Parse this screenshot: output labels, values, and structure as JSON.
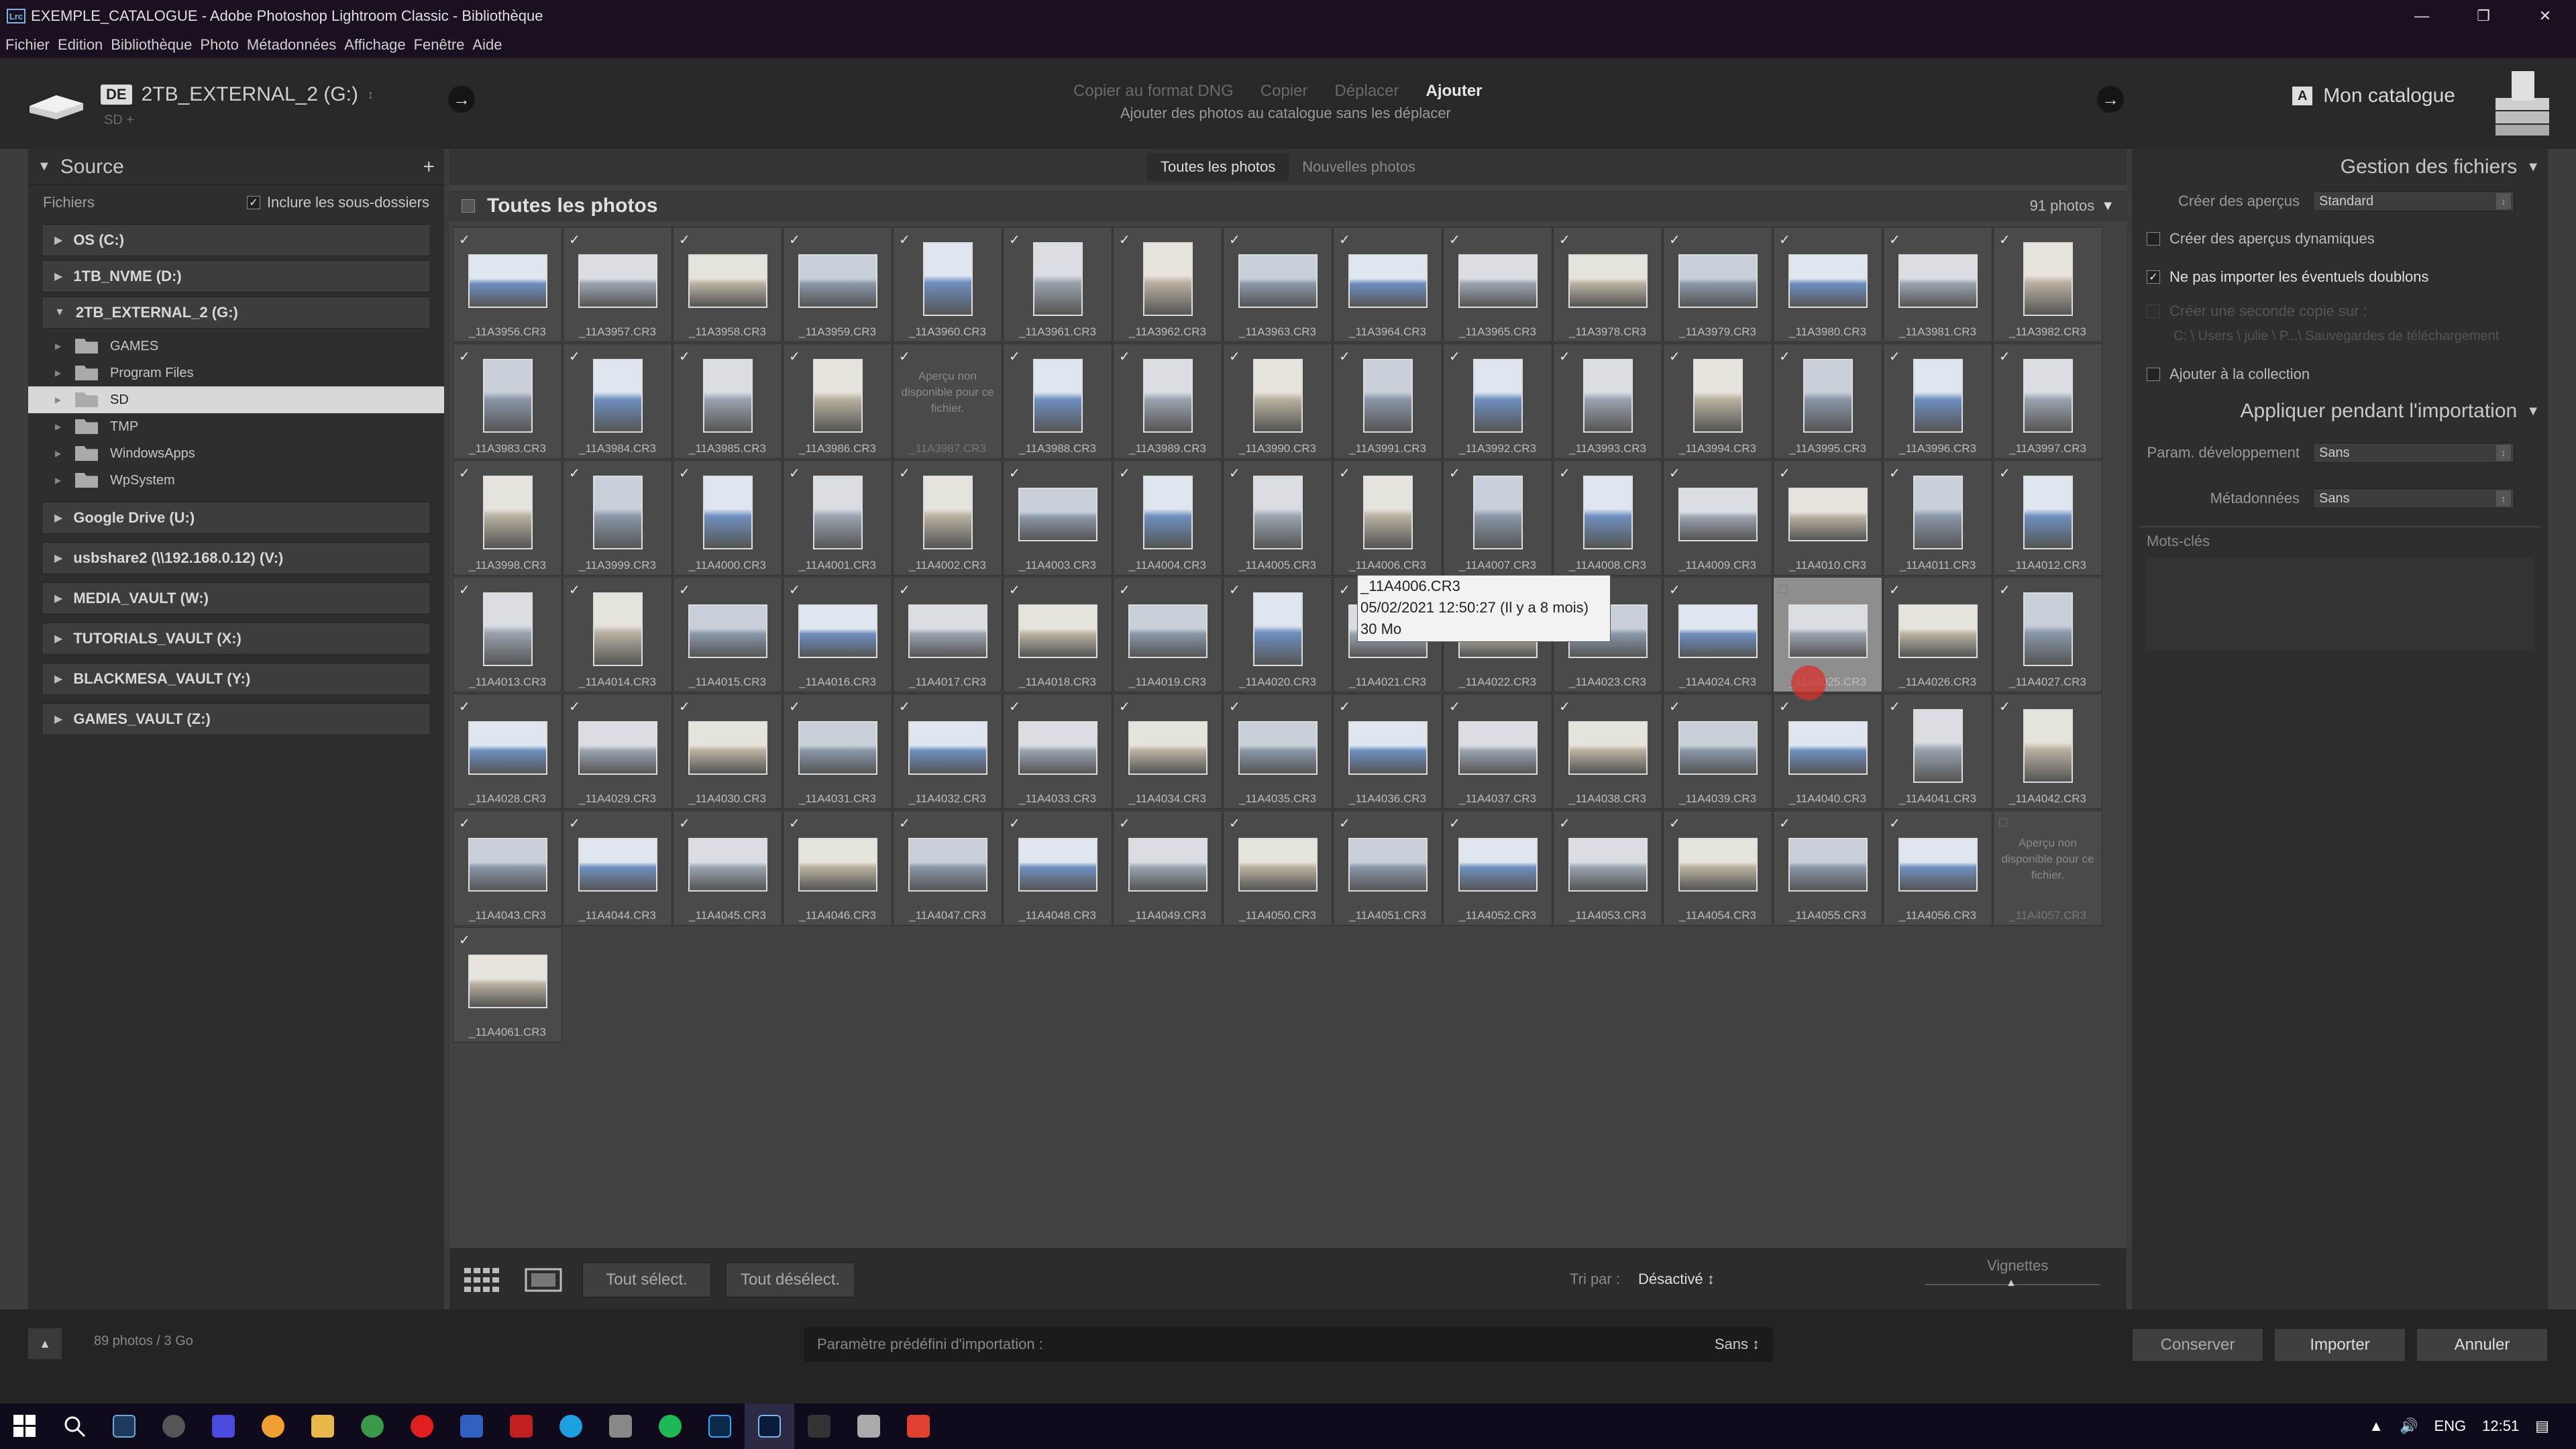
{
  "window": {
    "title": "EXEMPLE_CATALOGUE - Adobe Photoshop Lightroom Classic - Bibliothèque",
    "app_badge": "Lrc"
  },
  "menu": [
    "Fichier",
    "Edition",
    "Bibliothèque",
    "Photo",
    "Métadonnées",
    "Affichage",
    "Fenêtre",
    "Aide"
  ],
  "source_header": {
    "badge": "DE",
    "drive": "2TB_EXTERNAL_2 (G:)",
    "path": "SD +"
  },
  "modes": {
    "items": [
      "Copier au format DNG",
      "Copier",
      "Déplacer",
      "Ajouter"
    ],
    "active": "Ajouter",
    "subtitle": "Ajouter des photos au catalogue sans les déplacer"
  },
  "destination": {
    "badge": "A",
    "label": "Mon catalogue"
  },
  "left_panel": {
    "title": "Source",
    "files_label": "Fichiers",
    "include_sub": "Inclure les sous-dossiers",
    "volumes_top": [
      "OS (C:)",
      "1TB_NVME (D:)",
      "2TB_EXTERNAL_2 (G:)"
    ],
    "folders": [
      "GAMES",
      "Program Files",
      "SD",
      "TMP",
      "WindowsApps",
      "WpSystem"
    ],
    "selected_folder": "SD",
    "volumes_bottom": [
      "Google Drive (U:)",
      "usbshare2 (\\\\192.168.0.12) (V:)",
      "MEDIA_VAULT (W:)",
      "TUTORIALS_VAULT (X:)",
      "BLACKMESA_VAULT (Y:)",
      "GAMES_VAULT (Z:)"
    ]
  },
  "grid": {
    "tabs": [
      "Toutes les photos",
      "Nouvelles photos"
    ],
    "active_tab": "Toutes les photos",
    "title": "Toutes les photos",
    "count": "91 photos",
    "unavailable_text": "Aperçu non disponible pour ce fichier.",
    "tooltip": {
      "name": "_11A4006.CR3",
      "date": "05/02/2021 12:50:27 (Il y a 8 mois)",
      "size": "30 Mo"
    },
    "files": [
      "_11A3956.CR3",
      "_11A3957.CR3",
      "_11A3958.CR3",
      "_11A3959.CR3",
      "_11A3960.CR3",
      "_11A3961.CR3",
      "_11A3962.CR3",
      "_11A3963.CR3",
      "_11A3964.CR3",
      "_11A3965.CR3",
      "_11A3978.CR3",
      "_11A3979.CR3",
      "_11A3980.CR3",
      "_11A3981.CR3",
      "_11A3982.CR3",
      "_11A3983.CR3",
      "_11A3984.CR3",
      "_11A3985.CR3",
      "_11A3986.CR3",
      "_11A3987.CR3",
      "_11A3988.CR3",
      "_11A3989.CR3",
      "_11A3990.CR3",
      "_11A3991.CR3",
      "_11A3992.CR3",
      "_11A3993.CR3",
      "_11A3994.CR3",
      "_11A3995.CR3",
      "_11A3996.CR3",
      "_11A3997.CR3",
      "_11A3998.CR3",
      "_11A3999.CR3",
      "_11A4000.CR3",
      "_11A4001.CR3",
      "_11A4002.CR3",
      "_11A4003.CR3",
      "_11A4004.CR3",
      "_11A4005.CR3",
      "_11A4006.CR3",
      "_11A4007.CR3",
      "_11A4008.CR3",
      "_11A4009.CR3",
      "_11A4010.CR3",
      "_11A4011.CR3",
      "_11A4012.CR3",
      "_11A4013.CR3",
      "_11A4014.CR3",
      "_11A4015.CR3",
      "_11A4016.CR3",
      "_11A4017.CR3",
      "_11A4018.CR3",
      "_11A4019.CR3",
      "_11A4020.CR3",
      "_11A4021.CR3",
      "_11A4022.CR3",
      "_11A4023.CR3",
      "_11A4024.CR3",
      "_11A4025.CR3",
      "_11A4026.CR3",
      "_11A4027.CR3",
      "_11A4028.CR3",
      "_11A4029.CR3",
      "_11A4030.CR3",
      "_11A4031.CR3",
      "_11A4032.CR3",
      "_11A4033.CR3",
      "_11A4034.CR3",
      "_11A4035.CR3",
      "_11A4036.CR3",
      "_11A4037.CR3",
      "_11A4038.CR3",
      "_11A4039.CR3",
      "_11A4040.CR3",
      "_11A4041.CR3",
      "_11A4042.CR3",
      "_11A4043.CR3",
      "_11A4044.CR3",
      "_11A4045.CR3",
      "_11A4046.CR3",
      "_11A4047.CR3",
      "_11A4048.CR3",
      "_11A4049.CR3",
      "_11A4050.CR3",
      "_11A4051.CR3",
      "_11A4052.CR3",
      "_11A4053.CR3",
      "_11A4054.CR3",
      "_11A4055.CR3",
      "_11A4056.CR3",
      "_11A4057.CR3",
      "_11A4061.CR3"
    ],
    "unavailable": [
      "_11A3987.CR3",
      "_11A4057.CR3"
    ],
    "unchecked": [
      "_11A4025.CR3",
      "_11A4057.CR3"
    ],
    "highlighted": "_11A4025.CR3",
    "hovered": "_11A4006.CR3"
  },
  "grid_footer": {
    "select_all": "Tout sélect.",
    "deselect_all": "Tout désélect.",
    "sort_label": "Tri par :",
    "sort_value": "Désactivé",
    "thumbs_label": "Vignettes"
  },
  "right_panel": {
    "file_handling_title": "Gestion des fichiers",
    "previews_label": "Créer des aperçus",
    "previews_value": "Standard",
    "smart_previews": "Créer des aperçus dynamiques",
    "no_duplicates": "Ne pas importer les éventuels doublons",
    "second_copy": "Créer une seconde copie sur :",
    "second_copy_path": "C: \\ Users \\ julie \\ P...\\ Sauvegardes de téléchargement",
    "add_collection": "Ajouter à la collection",
    "apply_title": "Appliquer pendant l'importation",
    "dev_label": "Param. développement",
    "dev_value": "Sans",
    "meta_label": "Métadonnées",
    "meta_value": "Sans",
    "keywords_label": "Mots-clés"
  },
  "bottom": {
    "status": "89 photos / 3 Go",
    "preset_label": "Paramètre prédéfini d'importation :",
    "preset_value": "Sans",
    "keep": "Conserver",
    "import": "Importer",
    "cancel": "Annuler"
  },
  "taskbar": {
    "lang": "ENG",
    "time": "12:51"
  }
}
